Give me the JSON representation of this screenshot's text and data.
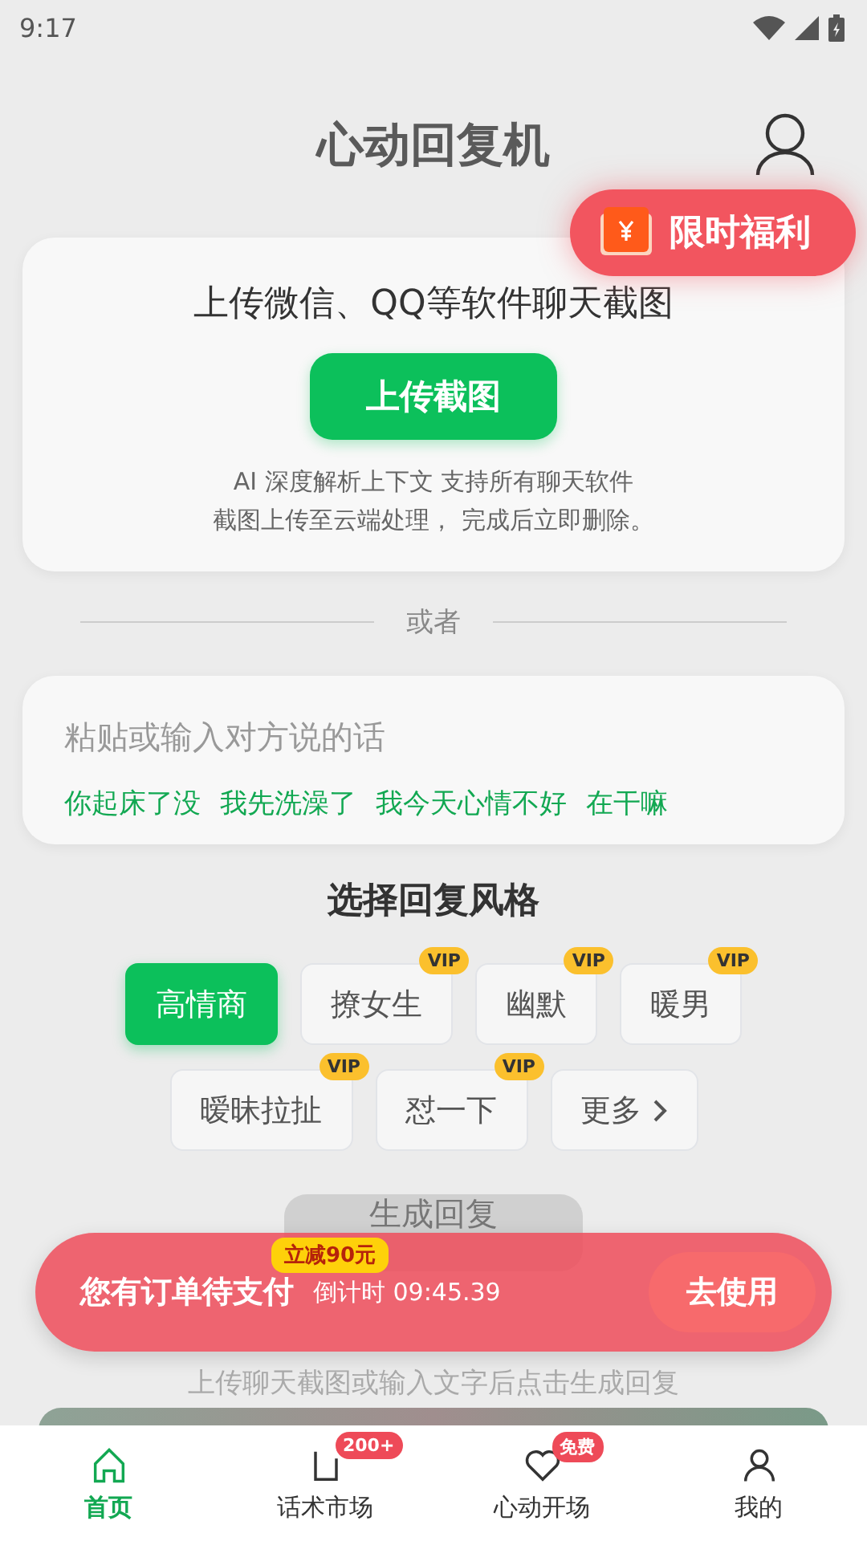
{
  "status_bar": {
    "time": "9:17"
  },
  "header": {
    "title": "心动回复机"
  },
  "promo_pill": {
    "label": "限时福利"
  },
  "upload_card": {
    "title": "上传微信、QQ等软件聊天截图",
    "button": "上传截图",
    "notes": [
      "AI 深度解析上下文 支持所有聊天软件",
      "截图上传至云端处理， 完成后立即删除。"
    ]
  },
  "divider": {
    "label": "或者"
  },
  "input_card": {
    "placeholder": "粘贴或输入对方说的话",
    "suggestions": [
      "你起床了没",
      "我先洗澡了",
      "我今天心情不好",
      "在干嘛"
    ]
  },
  "style_section": {
    "title": "选择回复风格",
    "rows": [
      [
        {
          "kind": "style",
          "label": "高情商",
          "selected": true
        },
        {
          "kind": "style",
          "label": "撩女生",
          "selected": false,
          "badge": "VIP"
        },
        {
          "kind": "style",
          "label": "幽默",
          "selected": false,
          "badge": "VIP"
        },
        {
          "kind": "style",
          "label": "暖男",
          "selected": false,
          "badge": "VIP"
        }
      ],
      [
        {
          "kind": "style",
          "label": "暧昧拉扯",
          "selected": false,
          "badge": "VIP"
        },
        {
          "kind": "style",
          "label": "怼一下",
          "selected": false,
          "badge": "VIP"
        },
        {
          "kind": "more",
          "label": "更多",
          "selected": false
        }
      ]
    ]
  },
  "generate": {
    "label": "生成回复",
    "disabled": true,
    "hint": "上传聊天截图或输入文字后点击生成回复"
  },
  "order_bar": {
    "title": "您有订单待支付",
    "discount": "立减90元",
    "countdown": "倒计时 09:45.39",
    "button": "去使用"
  },
  "nav": [
    {
      "kind": "home",
      "label": "首页",
      "selected": true
    },
    {
      "kind": "market",
      "label": "话术市场",
      "selected": false,
      "badge": "200+"
    },
    {
      "kind": "heart",
      "label": "心动开场",
      "selected": false,
      "badge": "免费"
    },
    {
      "kind": "user",
      "label": "我的",
      "selected": false
    }
  ]
}
